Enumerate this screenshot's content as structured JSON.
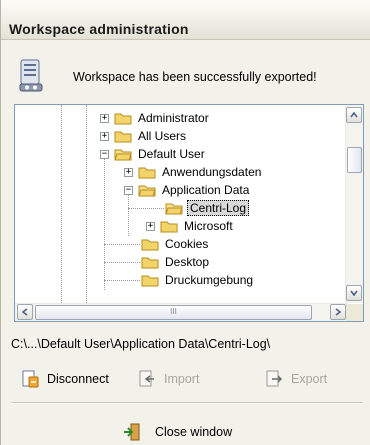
{
  "window": {
    "title": "Workspace administration"
  },
  "message": {
    "text": "Workspace has been successfully exported!",
    "icon": "server-icon"
  },
  "tree": {
    "items": [
      {
        "label": "Administrator",
        "expander": "+",
        "icon": "folder-icon"
      },
      {
        "label": "All Users",
        "expander": "+",
        "icon": "folder-icon"
      },
      {
        "label": "Default User",
        "expander": "−",
        "icon": "folder-open-icon"
      },
      {
        "label": "Anwendungsdaten",
        "expander": "+",
        "icon": "folder-icon"
      },
      {
        "label": "Application Data",
        "expander": "−",
        "icon": "folder-open-icon"
      },
      {
        "label": "Centri-Log",
        "expander": "",
        "icon": "folder-open-icon",
        "selected": true
      },
      {
        "label": "Microsoft",
        "expander": "+",
        "icon": "folder-icon"
      },
      {
        "label": "Cookies",
        "expander": "",
        "icon": "folder-icon"
      },
      {
        "label": "Desktop",
        "expander": "",
        "icon": "folder-icon"
      },
      {
        "label": "Druckumgebung",
        "expander": "",
        "icon": "folder-icon"
      }
    ],
    "scroll_hint": "III"
  },
  "path": "C:\\...\\Default User\\Application Data\\Centri-Log\\",
  "actions": {
    "disconnect": "Disconnect",
    "import": "Import",
    "export": "Export",
    "close": "Close window"
  },
  "colors": {
    "accent_folder": "#f3d46a",
    "disabled_text": "#a7a69f",
    "tree_border": "#7f9db9"
  }
}
